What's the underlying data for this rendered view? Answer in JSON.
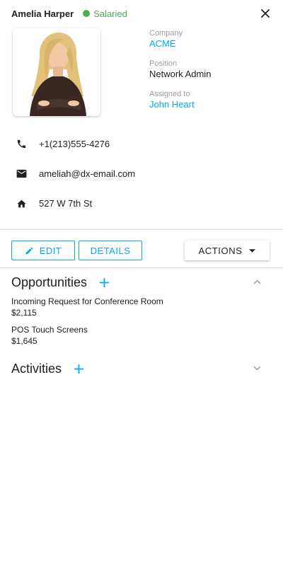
{
  "header": {
    "name": "Amelia Harper",
    "status": "Salaried",
    "status_color": "#4caf50"
  },
  "photo": {
    "alt": "Amelia Harper photo"
  },
  "info": {
    "company_label": "Company",
    "company": "ACME",
    "position_label": "Position",
    "position": "Network Admin",
    "assigned_label": "Assigned to",
    "assigned": "John Heart"
  },
  "contact": {
    "phone": "+1(213)555-4276",
    "email": "ameliah@dx-email.com",
    "address": "527 W 7th St"
  },
  "toolbar": {
    "edit": "EDIT",
    "details": "DETAILS",
    "actions": "ACTIONS"
  },
  "opportunities": {
    "title": "Opportunities",
    "items": [
      {
        "title": "Incoming Request for Conference Room",
        "value": "$2,115"
      },
      {
        "title": "POS Touch Screens",
        "value": "$1,645"
      }
    ]
  },
  "activities": {
    "title": "Activities"
  },
  "colors": {
    "accent": "#03a9f4",
    "text": "#212121",
    "muted": "#9e9e9e",
    "divider": "#e0e0e0"
  }
}
